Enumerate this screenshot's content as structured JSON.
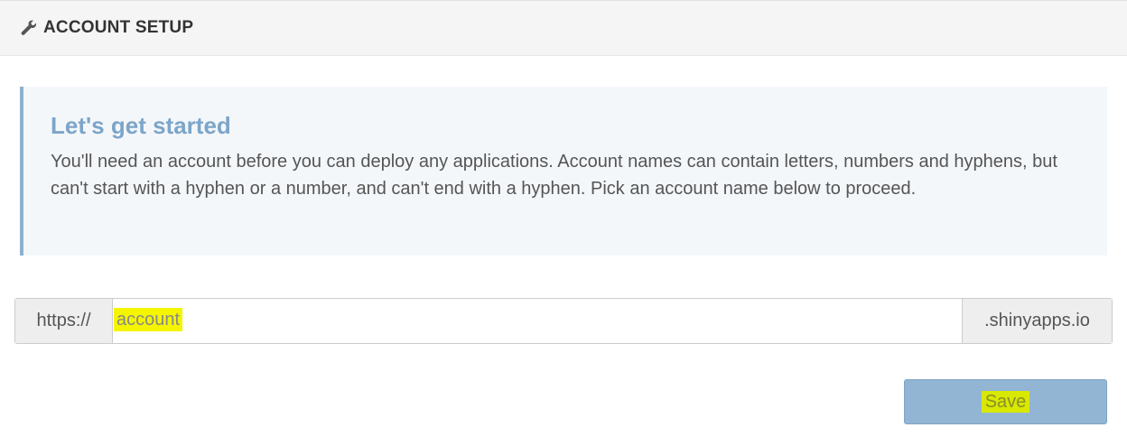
{
  "header": {
    "icon": "wrench-icon",
    "title": "ACCOUNT SETUP"
  },
  "callout": {
    "heading": "Let's get started",
    "body": "You'll need an account before you can deploy any applications. Account names can contain letters, numbers and hyphens, but can't start with a hyphen or a number, and can't end with a hyphen. Pick an account name below to proceed."
  },
  "url": {
    "prefix": "https://",
    "placeholder": "account",
    "value": "",
    "suffix": ".shinyapps.io"
  },
  "actions": {
    "save_label": "Save"
  },
  "colors": {
    "accent": "#7ca5c9",
    "button": "#93b5d4",
    "highlight": "#f2f200"
  }
}
